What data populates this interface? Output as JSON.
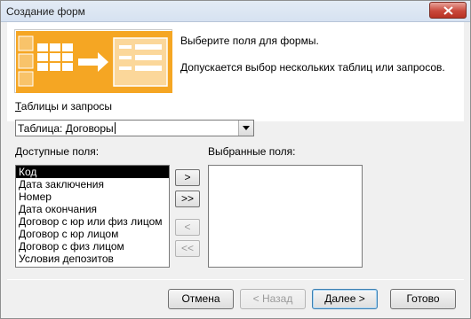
{
  "window": {
    "title": "Создание форм"
  },
  "instructions": {
    "line1": "Выберите поля для формы.",
    "line2": "Допускается выбор нескольких таблиц или запросов."
  },
  "tables": {
    "label_underlined": "Т",
    "label_rest": "аблицы и запросы",
    "selected": "Таблица: Договоры"
  },
  "available": {
    "label_underlined": "Д",
    "label_rest": "оступные поля:",
    "items": [
      "Код",
      "Дата заключения",
      "Номер",
      "Дата окончания",
      "Договор с юр или физ лицом",
      "Договор с юр лицом",
      "Договор с физ лицом",
      "Условия депозитов"
    ],
    "selected_index": 0
  },
  "selected_fields": {
    "label": "Выбранные поля:",
    "items": []
  },
  "move_buttons": {
    "add": ">",
    "add_all": ">>",
    "remove": "<",
    "remove_all": "<<"
  },
  "footer": {
    "cancel": "Отмена",
    "back": "< Назад",
    "next": "Далее >",
    "finish": "Готово"
  },
  "colors": {
    "graphic_accent": "#f5a623",
    "selection": "#000000"
  },
  "icons": {
    "close": "close-icon",
    "dropdown": "chevron-down-icon",
    "wizard": "form-wizard-graphic"
  }
}
